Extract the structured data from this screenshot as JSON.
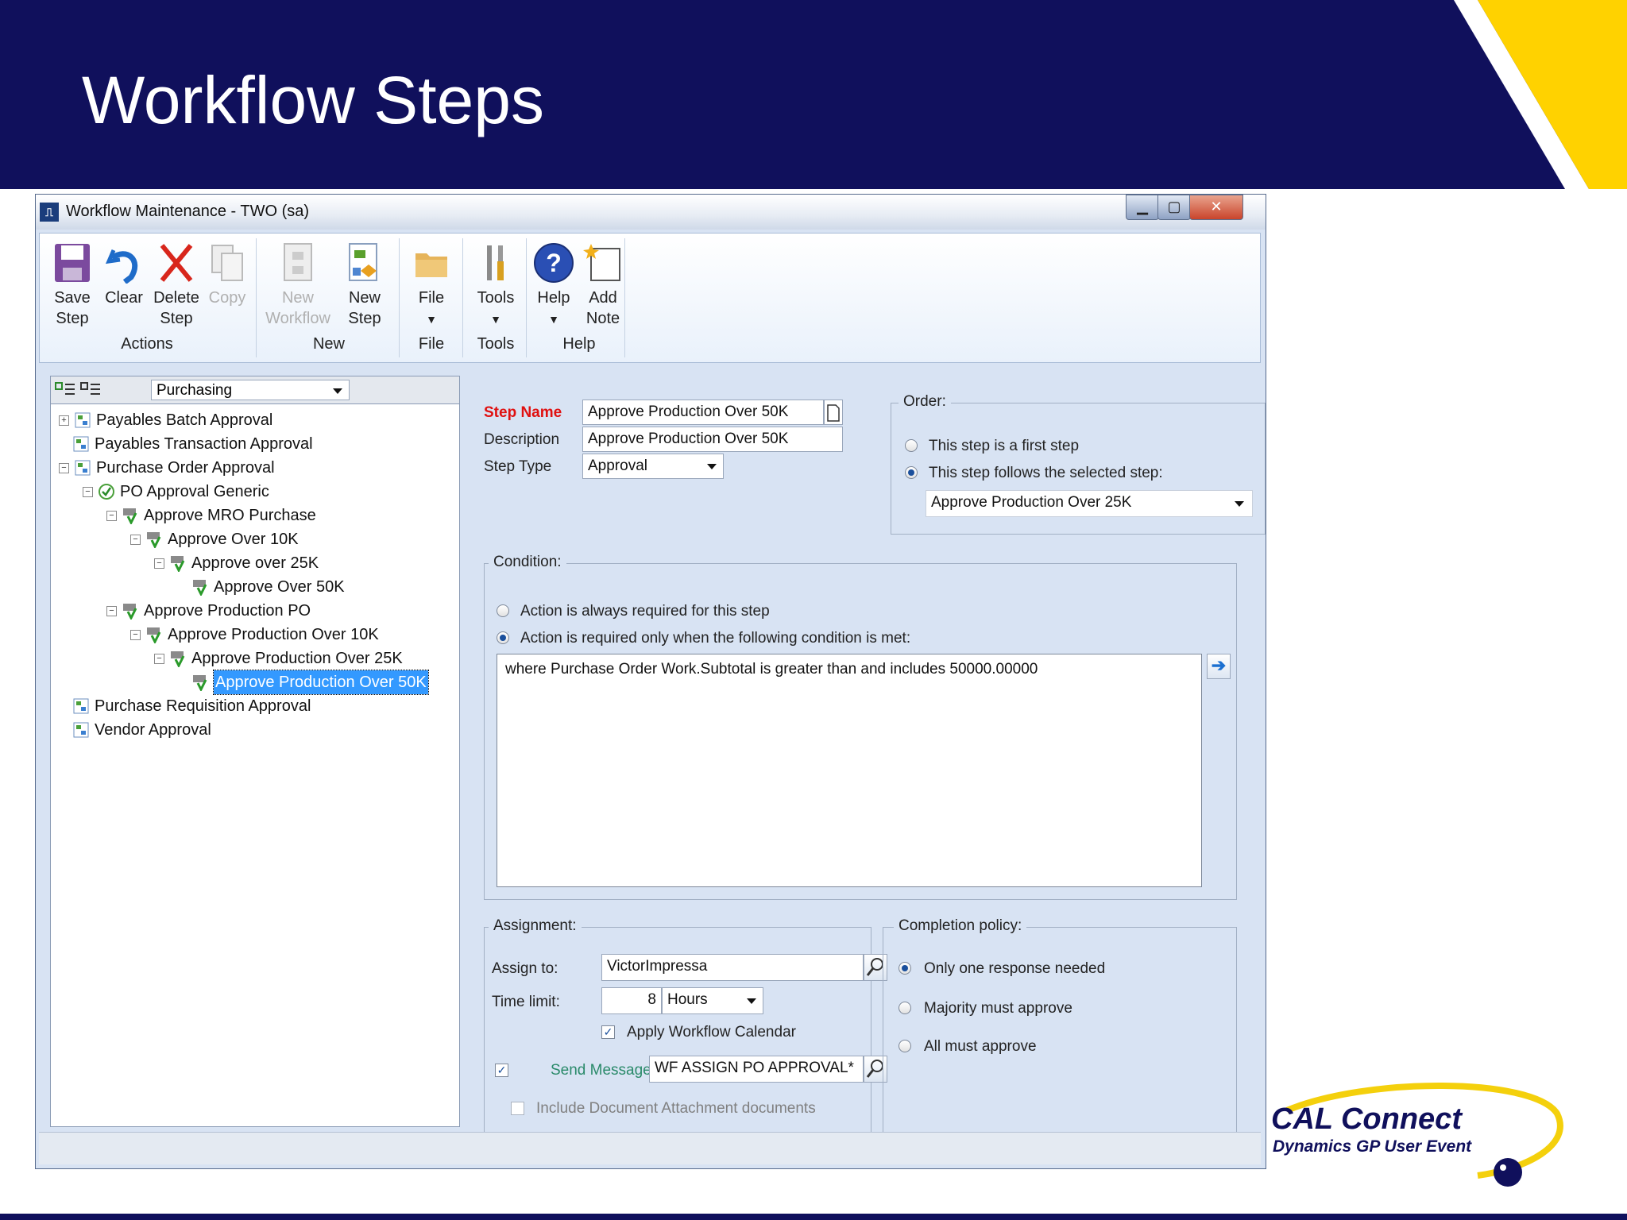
{
  "slide": {
    "title": "Workflow Steps"
  },
  "window": {
    "title": "Workflow Maintenance  -  TWO (sa)"
  },
  "ribbon": {
    "buttons": {
      "save": "Save\nStep",
      "clear": "Clear",
      "delete": "Delete\nStep",
      "copy": "Copy",
      "new_workflow": "New\nWorkflow",
      "new_step": "New\nStep",
      "file": "File",
      "tools": "Tools",
      "help": "Help",
      "add_note": "Add\nNote"
    },
    "groups": {
      "actions": "Actions",
      "new": "New",
      "file": "File",
      "tools": "Tools",
      "help": "Help"
    }
  },
  "tree": {
    "category": "Purchasing",
    "items": [
      "Payables Batch Approval",
      "Payables Transaction Approval",
      "Purchase Order Approval",
      "PO Approval Generic",
      "Approve MRO Purchase",
      "Approve Over 10K",
      "Approve over 25K",
      "Approve Over 50K",
      "Approve Production PO",
      "Approve Production Over 10K",
      "Approve Production Over 25K",
      "Approve Production Over 50K",
      "Purchase Requisition Approval",
      "Vendor Approval"
    ]
  },
  "step": {
    "name_label": "Step Name",
    "name": "Approve Production Over 50K",
    "description_label": "Description",
    "description": "Approve Production Over 50K",
    "type_label": "Step Type",
    "type": "Approval"
  },
  "order": {
    "title": "Order:",
    "first": "This step is a first step",
    "follows": "This step follows the selected step:",
    "selected_step": "Approve Production Over 25K"
  },
  "condition": {
    "title": "Condition:",
    "always": "Action is always required for this step",
    "when": "Action is required only when the following condition is met:",
    "text": "where Purchase Order Work.Subtotal is greater than and includes 50000.00000"
  },
  "assignment": {
    "title": "Assignment:",
    "assign_label": "Assign to:",
    "assign_to": "VictorImpressa",
    "time_label": "Time limit:",
    "time_value": "8",
    "time_unit": "Hours",
    "calendar": "Apply Workflow Calendar",
    "send_label": "Send Message:",
    "message": "WF ASSIGN PO APPROVAL*",
    "include": "Include Document Attachment documents"
  },
  "completion": {
    "title": "Completion policy:",
    "one": "Only one response needed",
    "majority": "Majority must approve",
    "all": "All must approve"
  },
  "logo": {
    "line1": "CAL Connect",
    "line2": "Dynamics GP User Event"
  },
  "colors": {
    "banner": "#10105c",
    "accent": "#ffd200",
    "required_label": "#e01010",
    "selection": "#3399ff"
  }
}
